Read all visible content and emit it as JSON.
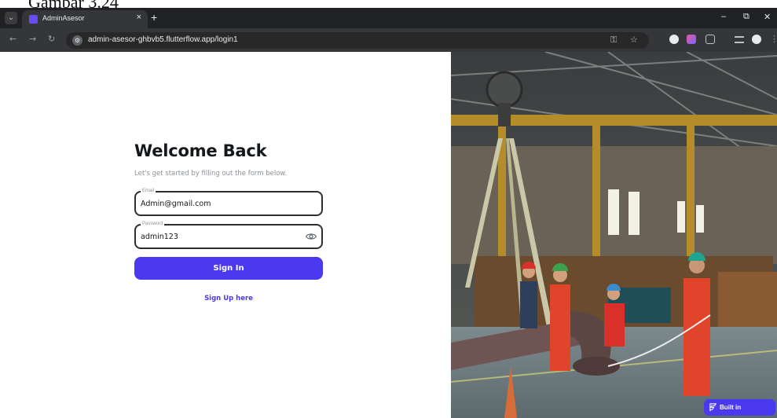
{
  "caption": "Gambar 3.24",
  "browser": {
    "tab_title": "AdminAsesor",
    "tab_close": "×",
    "new_tab": "+",
    "url": "admin-asesor-ghbvb5.flutterflow.app/login1",
    "controls": {
      "minimize": "–",
      "maximize": "⧉",
      "close": "✕"
    },
    "nav": {
      "back": "←",
      "forward": "→",
      "reload": "↻"
    }
  },
  "login": {
    "title": "Welcome Back",
    "subtitle": "Let's get started by filling out the form below.",
    "email": {
      "label": "Email",
      "value": "Admin@gmail.com"
    },
    "password": {
      "label": "Password",
      "value": "admin123"
    },
    "sign_in_label": "Sign In",
    "sign_up_label": "Sign Up here"
  },
  "badge": {
    "label": "Built in FlutterFlow"
  },
  "colors": {
    "accent": "#4B39EF",
    "chrome_dark": "#202124",
    "text_dark": "#14181B"
  },
  "icons": [
    "tab-search-icon",
    "favicon-icon",
    "site-info-icon",
    "password-key-icon",
    "star-icon",
    "extensions-icon",
    "eye-icon",
    "flutterflow-icon"
  ]
}
